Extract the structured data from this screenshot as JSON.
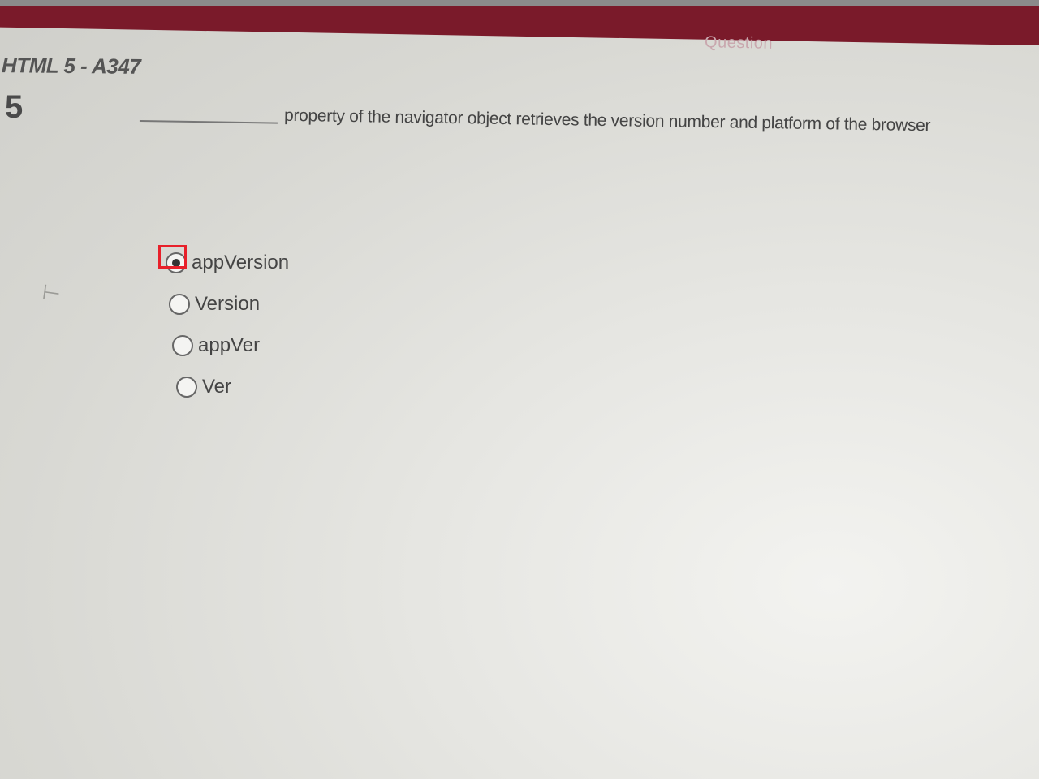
{
  "header": {
    "question_tab_label": "Question"
  },
  "exam": {
    "title": "HTML 5 - A347",
    "question_number": "5"
  },
  "question": {
    "text": "property of the navigator object retrieves the version number and platform of the browser"
  },
  "options": [
    {
      "label": "appVersion",
      "selected": true
    },
    {
      "label": "Version",
      "selected": false
    },
    {
      "label": "appVer",
      "selected": false
    },
    {
      "label": "Ver",
      "selected": false
    }
  ],
  "colors": {
    "header_band": "#7a1a2a",
    "highlight": "#e8202a",
    "text": "#444444"
  }
}
